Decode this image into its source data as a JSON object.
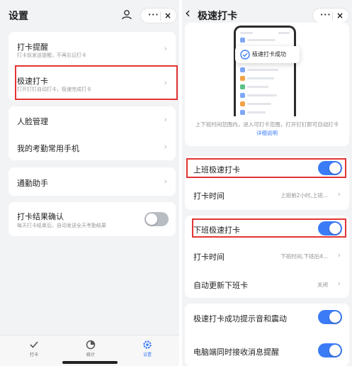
{
  "left": {
    "title": "设置",
    "capsule": {
      "more": "···",
      "close": "×"
    },
    "card1": [
      {
        "label": "打卡提醒",
        "sub": "打卡前发送提醒，不再忘记打卡"
      },
      {
        "label": "极速打卡",
        "sub": "打开钉钉自动打卡，极速完成打卡"
      }
    ],
    "card2": [
      {
        "label": "人脸管理"
      },
      {
        "label": "我的考勤常用手机"
      }
    ],
    "card3": [
      {
        "label": "通勤助手"
      }
    ],
    "card4": {
      "label": "打卡结果确认",
      "sub": "每天打卡结束后，自动发送全天考勤结果",
      "toggle": "off"
    },
    "tabs": [
      {
        "label": "打卡",
        "icon": "checkin-icon"
      },
      {
        "label": "统计",
        "icon": "stats-icon"
      },
      {
        "label": "设置",
        "icon": "settings-icon",
        "active": true
      }
    ]
  },
  "right": {
    "back": "‹",
    "title": "极速打卡",
    "capsule": {
      "more": "···",
      "close": "×"
    },
    "popup_text": "极速打卡成功",
    "desc_text": "上下班时间范围内，进入可打卡范围，打开钉钉即可自动打卡",
    "desc_link": "详细说明",
    "rows": {
      "on_toggle": "上班极速打卡",
      "on_time_label": "打卡时间",
      "on_time_value": "上班前2小时,上班...",
      "off_toggle": "下班极速打卡",
      "off_time_label": "打卡时间",
      "off_time_value": "下班时间,下班后4...",
      "auto_update_label": "自动更新下班卡",
      "auto_update_value": "关闭",
      "sound_label": "极速打卡成功提示音和震动",
      "pc_label": "电脑端同时接收消息提醒"
    }
  },
  "colors": {
    "accent": "#3b7bf6",
    "highlight": "#e33434",
    "background": "#f2f3f5"
  }
}
